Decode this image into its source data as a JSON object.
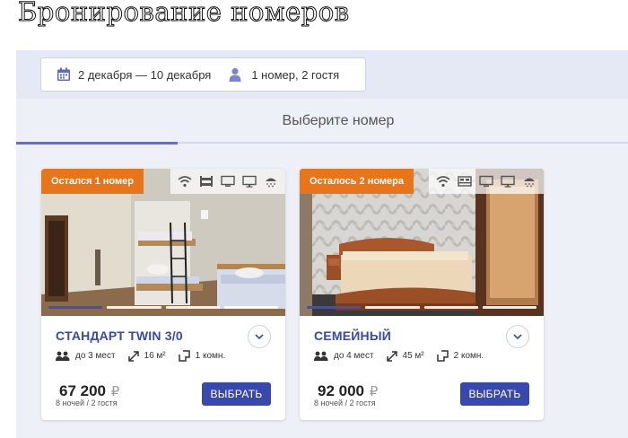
{
  "page": {
    "title": "Бронирование номеров"
  },
  "booking": {
    "dates": "2 декабря — 10 декабря",
    "guests": "1 номер, 2 гостя"
  },
  "section": {
    "label": "Выберите номер"
  },
  "colors": {
    "accent": "#3949ab",
    "badge": "#e8751a",
    "room_name": "#3a48a8"
  },
  "rooms": [
    {
      "badge": "Остался 1 номер",
      "amenities": [
        "wifi-icon",
        "bunk-bed-icon",
        "tv-icon",
        "monitor-icon",
        "shower-icon"
      ],
      "name": "СТАНДАРТ TWIN 3/0",
      "capacity": "до 3 мест",
      "area": "16 м²",
      "rooms": "1 комн.",
      "price": "67 200",
      "currency": "₽",
      "price_note": "8 ночей / 2 гостя",
      "button": "ВЫБРАТЬ",
      "photo_index": 1,
      "photo_count": 4
    },
    {
      "badge": "Осталось 2 номера",
      "amenities": [
        "wifi-icon",
        "double-bed-icon",
        "tv-icon",
        "monitor-icon",
        "shower-icon"
      ],
      "name": "СЕМЕЙНЫЙ",
      "capacity": "до 4 мест",
      "area": "45 м²",
      "rooms": "2 комн.",
      "price": "92 000",
      "currency": "₽",
      "price_note": "8 ночей / 2 гостя",
      "button": "ВЫБРАТЬ",
      "photo_index": 1,
      "photo_count": 4
    }
  ]
}
